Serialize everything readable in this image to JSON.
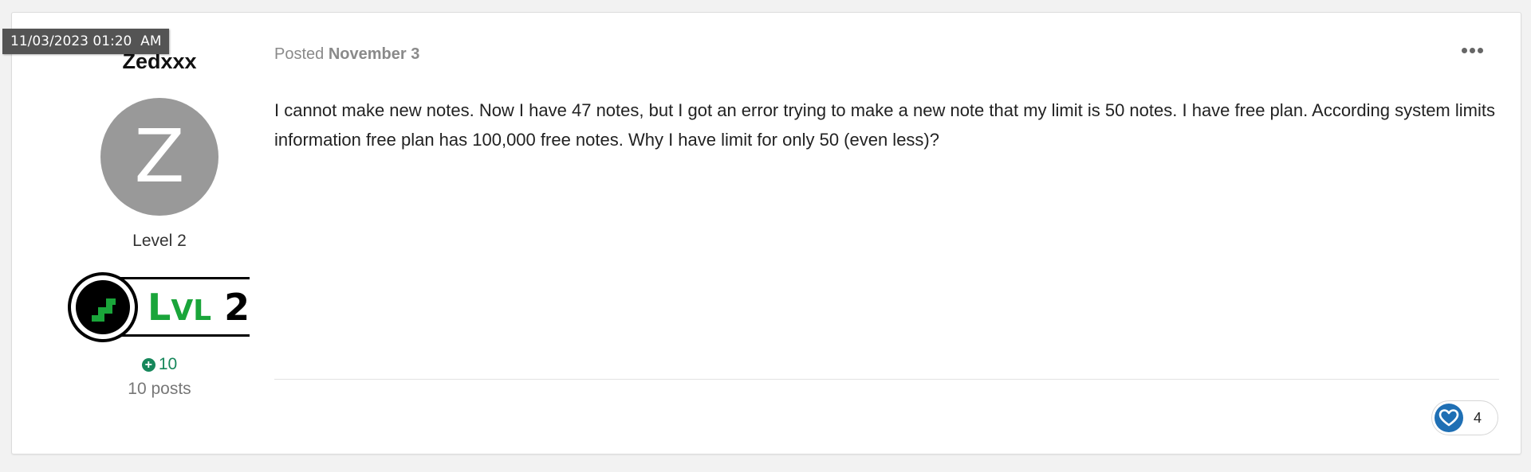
{
  "timestamp_overlay": "11/03/2023 01:20  AM",
  "author": {
    "name": "Zedxxx",
    "avatar_letter": "Z",
    "rank_title": "Level 2",
    "badge": {
      "word": "Lvl",
      "number": "2",
      "colors": {
        "word": "#1aa53a",
        "ring": "#000000",
        "steps": "#1aa53a"
      }
    },
    "reputation": "10",
    "post_count": "10 posts"
  },
  "post": {
    "posted_prefix": "Posted",
    "posted_date": "November 3",
    "body": "I cannot make new notes. Now I have 47 notes, but I got an error trying to make a new note that my limit is 50 notes. I have free plan. According system limits information free plan has 100,000 free notes. Why I have limit for only 50 (even less)?",
    "more_icon": "ellipsis-icon",
    "reaction": {
      "icon": "heart-icon",
      "count": "4",
      "color": "#1f6fb4"
    }
  }
}
